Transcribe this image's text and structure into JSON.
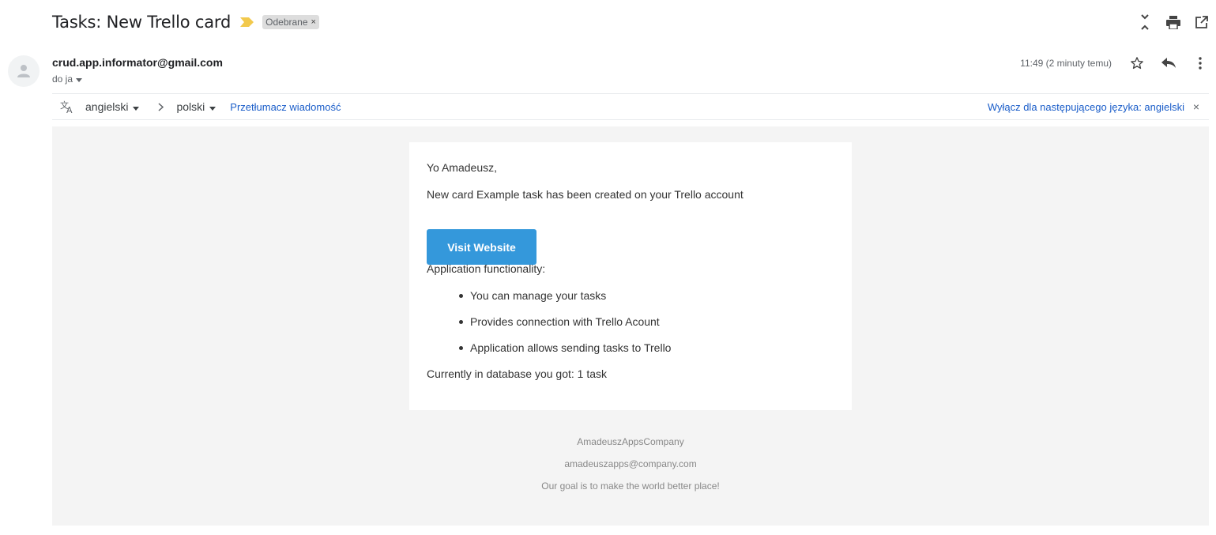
{
  "subject": "Tasks: New Trello card",
  "label": {
    "text": "Odebrane",
    "close": "×"
  },
  "icons": {
    "importance": "importance-marker-icon",
    "collapse": "collapse-all-icon",
    "print": "print-icon",
    "new_window": "open-new-window-icon",
    "avatar": "person-icon",
    "star": "star-icon",
    "reply": "reply-icon",
    "more": "more-vert-icon",
    "translate": "translate-icon"
  },
  "colors": {
    "importance": "#f2c94c",
    "link": "#1a5dc9",
    "button": "#3498db",
    "email_bg": "#f4f4f4"
  },
  "sender": {
    "email": "crud.app.informator@gmail.com",
    "to": "do ja"
  },
  "timestamp": "11:49 (2 minuty temu)",
  "translation": {
    "from_lang": "angielski",
    "to_lang": "polski",
    "translate_link": "Przetłumacz wiadomość",
    "disable_link": "Wyłącz dla następującego języka: angielski",
    "close": "×"
  },
  "body": {
    "greeting": "Yo Amadeusz,",
    "message": "New card Example task has been created on your Trello account",
    "button": "Visit Website",
    "functionality_heading": "Application functionality:",
    "features": [
      "You can manage your tasks",
      "Provides connection with Trello Acount",
      "Application allows sending tasks to Trello"
    ],
    "db_status": "Currently in database you got: 1 task"
  },
  "footer": {
    "company": "AmadeuszAppsCompany",
    "email": "amadeuszapps@company.com",
    "slogan": "Our goal is to make the world better place!"
  }
}
